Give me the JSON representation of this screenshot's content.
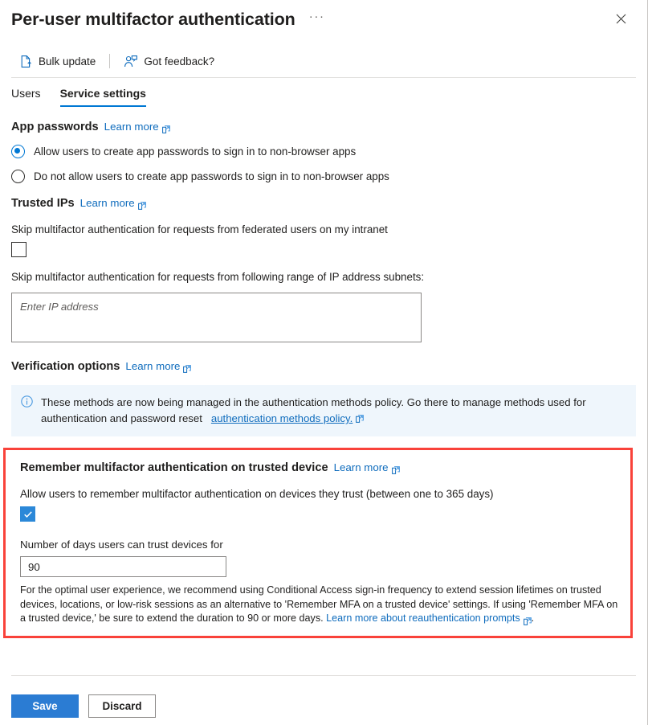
{
  "header": {
    "title": "Per-user multifactor authentication",
    "more_label": "···",
    "close_label": "✕"
  },
  "commandbar": {
    "items": [
      {
        "label": "Bulk update",
        "icon": "bulk-update-icon"
      },
      {
        "label": "Got feedback?",
        "icon": "feedback-icon"
      }
    ]
  },
  "tabs": [
    {
      "label": "Users",
      "active": false
    },
    {
      "label": "Service settings",
      "active": true
    }
  ],
  "learn_more_label": "Learn more",
  "app_passwords": {
    "heading": "App passwords",
    "options": [
      {
        "label": "Allow users to create app passwords to sign in to non-browser apps",
        "selected": true
      },
      {
        "label": "Do not allow users to create app passwords to sign in to non-browser apps",
        "selected": false
      }
    ]
  },
  "trusted_ips": {
    "heading": "Trusted IPs",
    "skip_federated_label": "Skip multifactor authentication for requests from federated users on my intranet",
    "skip_federated_checked": false,
    "subnets_label": "Skip multifactor authentication for requests from following range of IP address subnets:",
    "ip_placeholder": "Enter IP address",
    "ip_value": ""
  },
  "verification_options": {
    "heading": "Verification options",
    "info_text_1": "These methods are now being managed in the authentication methods policy. Go there to manage methods used for authentication and password reset",
    "info_link": "authentication methods policy.",
    "info_icon": "info-circle-icon"
  },
  "remember": {
    "heading": "Remember multifactor authentication on trusted device",
    "allow_label": "Allow users to remember multifactor authentication on devices they trust (between one to 365 days)",
    "allow_checked": true,
    "days_label": "Number of days users can trust devices for",
    "days_value": "90",
    "note_text_1": "For the optimal user experience, we recommend using Conditional Access sign-in frequency to extend session lifetimes on trusted devices, locations, or low-risk sessions as an alternative to 'Remember MFA on a trusted device' settings. If using 'Remember MFA on a trusted device,' be sure to extend the duration to 90 or more days.",
    "note_link": "Learn more about reauthentication prompts",
    "note_text_2": ".",
    "highlight_color": "#f9423a"
  },
  "footer": {
    "save_label": "Save",
    "discard_label": "Discard"
  },
  "colors": {
    "accent": "#0078d4",
    "link": "#0f6cbd",
    "primary_button": "#2b7cd3",
    "info_bg": "#eff6fc",
    "highlight": "#f9423a"
  }
}
